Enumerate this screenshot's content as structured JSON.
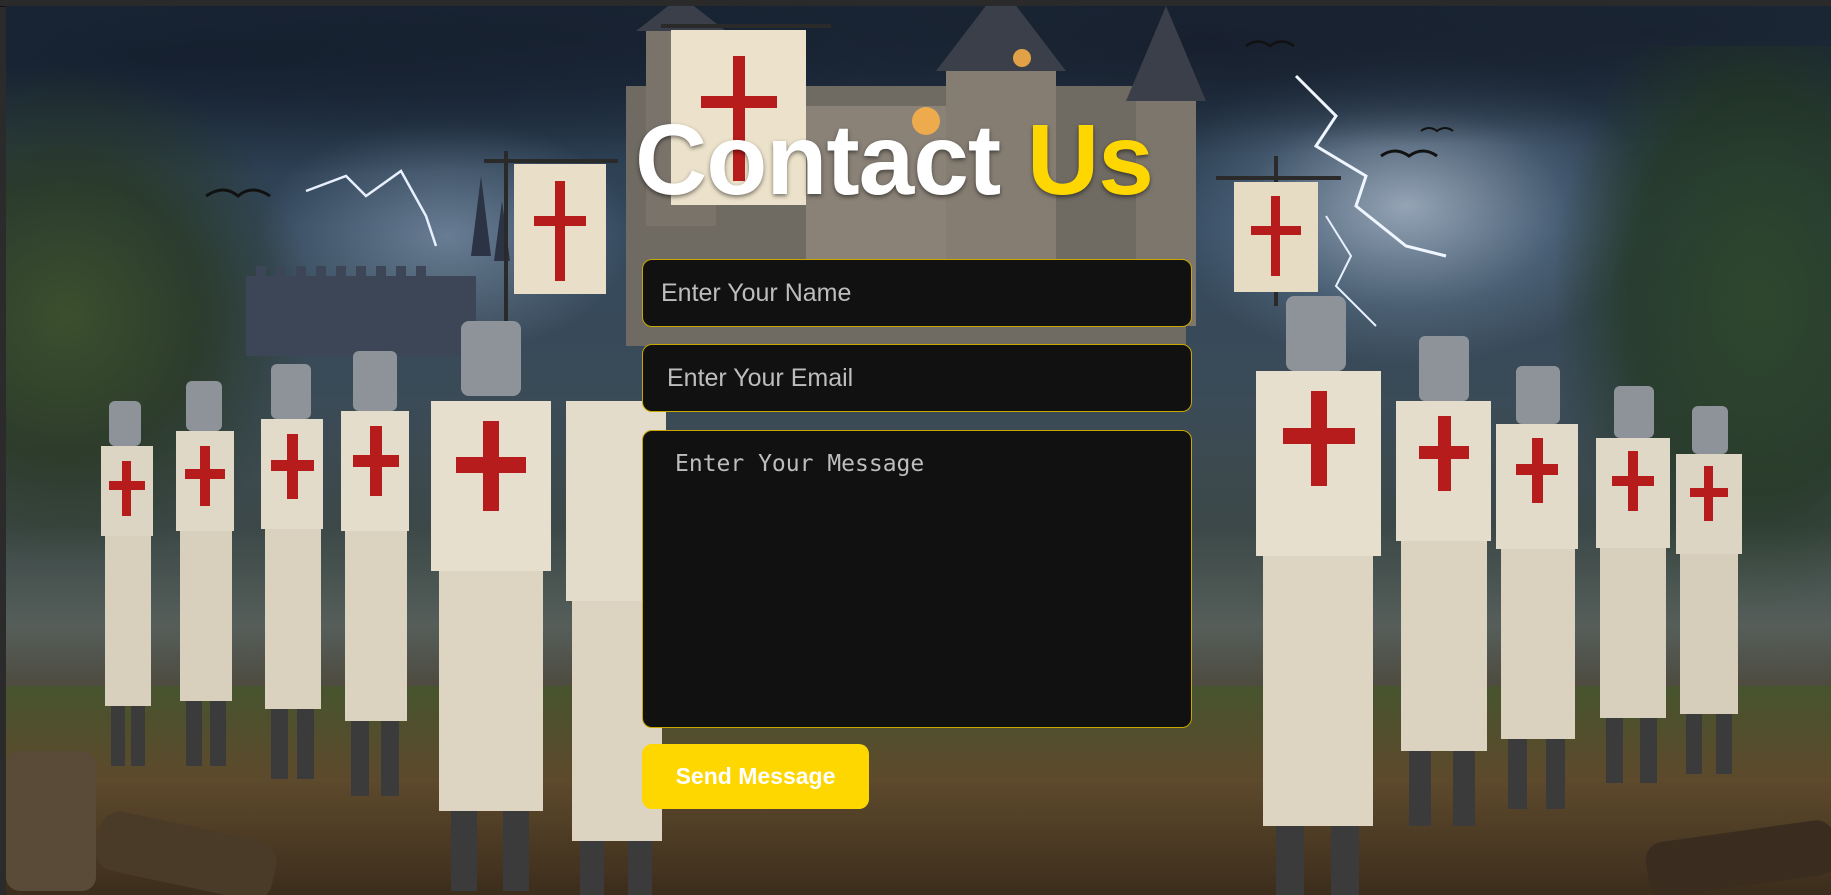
{
  "page": {
    "background_scene": "templar-knights-castle-storm"
  },
  "heading": {
    "main": "Contact",
    "accent": "Us",
    "main_color": "#ffffff",
    "accent_color": "#ffd700"
  },
  "form": {
    "name_placeholder": "Enter Your Name",
    "name_value": "",
    "email_placeholder": "Enter Your Email",
    "email_value": "",
    "message_placeholder": "Enter Your Message",
    "message_value": "",
    "submit_label": "Send Message",
    "field_background": "#111111",
    "field_border": "#c9a700",
    "button_color": "#ffd700"
  }
}
